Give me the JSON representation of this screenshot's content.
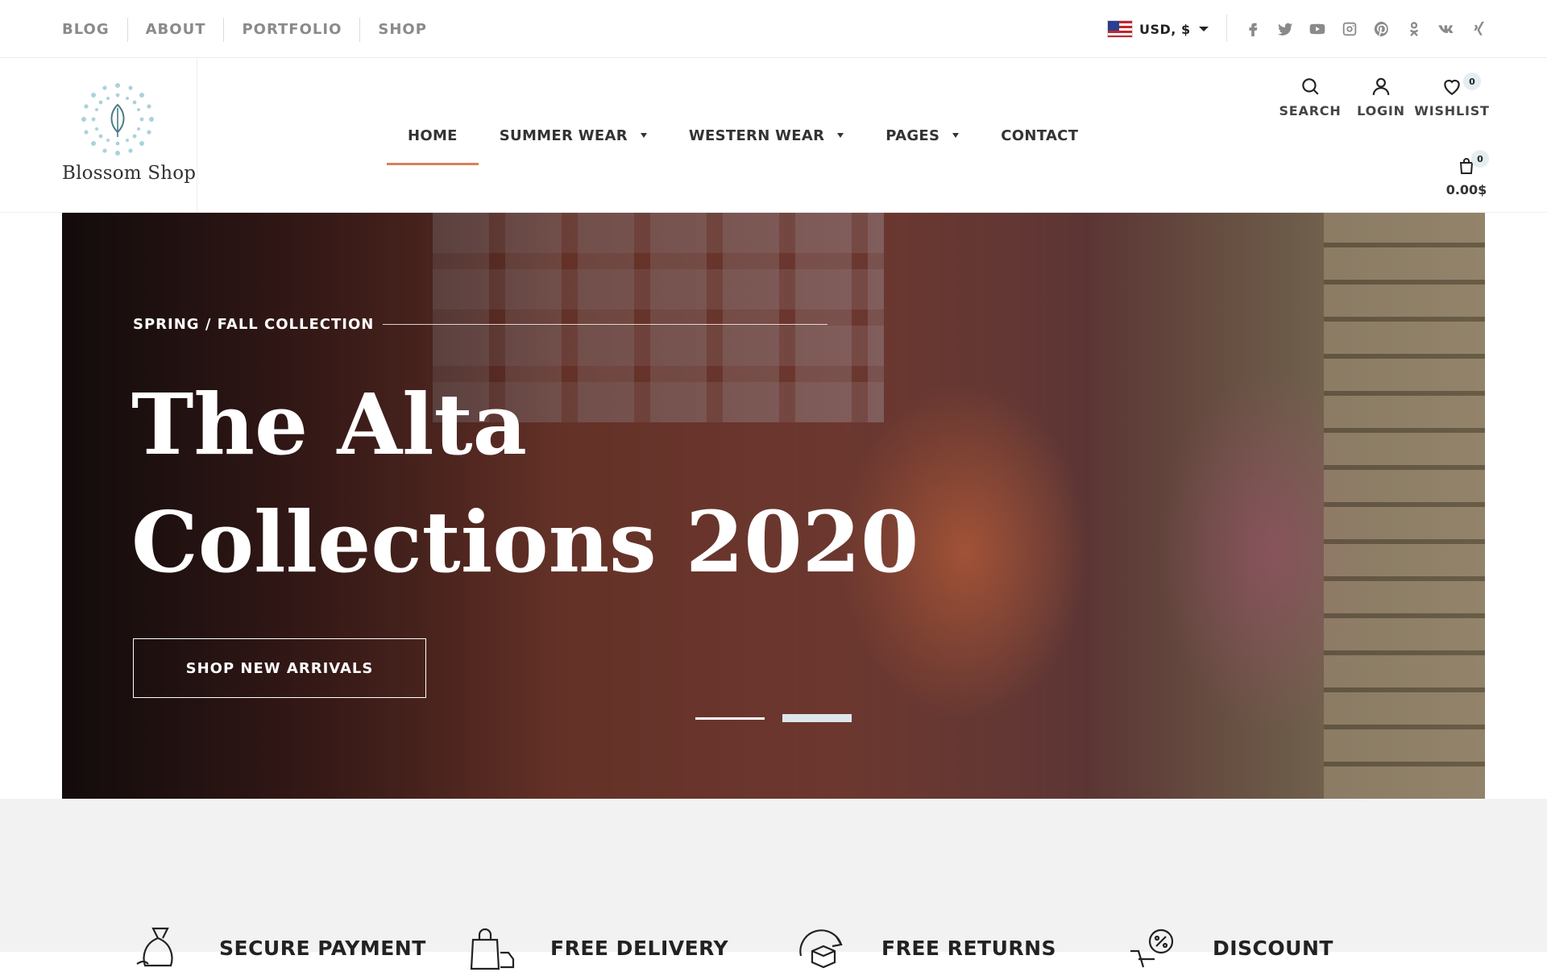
{
  "topbar": {
    "links": [
      "BLOG",
      "ABOUT",
      "PORTFOLIO",
      "SHOP"
    ],
    "currency": "USD, $",
    "socials": [
      "facebook-icon",
      "twitter-icon",
      "youtube-icon",
      "instagram-icon",
      "pinterest-icon",
      "odnoklassniki-icon",
      "vk-icon",
      "xing-icon"
    ]
  },
  "header": {
    "logo_text": "Blossom Shop",
    "nav": [
      {
        "label": "HOME",
        "active": true
      },
      {
        "label": "SUMMER WEAR",
        "dropdown": true
      },
      {
        "label": "WESTERN WEAR",
        "dropdown": true
      },
      {
        "label": "PAGES",
        "dropdown": true
      },
      {
        "label": "CONTACT"
      }
    ],
    "actions": {
      "search": "SEARCH",
      "login": "LOGIN",
      "wishlist": "WISHLIST",
      "wishlist_count": "0",
      "cart_total": "0.00$",
      "cart_count": "0"
    }
  },
  "hero": {
    "subtitle": "SPRING / FALL COLLECTION",
    "title_line1": "The Alta",
    "title_line2": "Collections 2020",
    "button": "SHOP NEW ARRIVALS",
    "slides": 2,
    "active_slide": 2
  },
  "features": [
    {
      "icon": "money-bag-icon",
      "title": "SECURE PAYMENT"
    },
    {
      "icon": "shopping-bag-icon",
      "title": "FREE DELIVERY"
    },
    {
      "icon": "return-box-icon",
      "title": "FREE RETURNS"
    },
    {
      "icon": "discount-icon",
      "title": "DISCOUNT"
    }
  ],
  "colors": {
    "accent": "#d9815a",
    "muted_text": "#8a8a8a",
    "features_bg": "#f2f2f2"
  }
}
